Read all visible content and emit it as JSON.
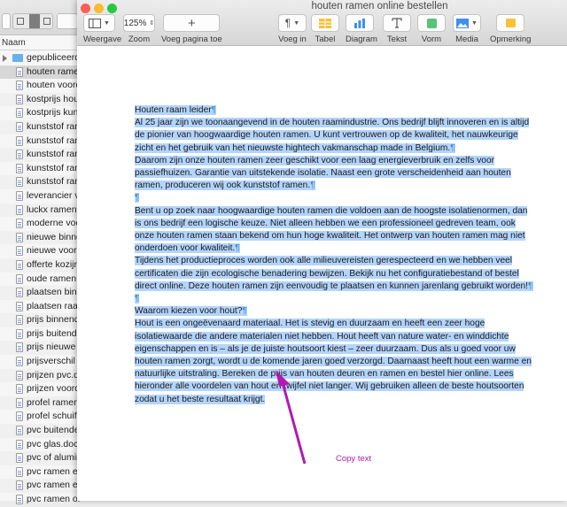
{
  "finder": {
    "column_header": "Naam",
    "rows": [
      {
        "label": "gepubliceerd",
        "kind": "folder"
      },
      {
        "label": "houten ramen",
        "kind": "file",
        "selected": true
      },
      {
        "label": "houten voord",
        "kind": "file"
      },
      {
        "label": "kostprijs hou",
        "kind": "file"
      },
      {
        "label": "kostprijs kuns",
        "kind": "file"
      },
      {
        "label": "kunststof ram",
        "kind": "file"
      },
      {
        "label": "kunststof ram",
        "kind": "file"
      },
      {
        "label": "kunststof ram",
        "kind": "file"
      },
      {
        "label": "kunststof ram",
        "kind": "file"
      },
      {
        "label": "kunststof ram",
        "kind": "file"
      },
      {
        "label": "leverancier v",
        "kind": "file"
      },
      {
        "label": "luckx ramen",
        "kind": "file"
      },
      {
        "label": "moderne voo",
        "kind": "file"
      },
      {
        "label": "nieuwe binne",
        "kind": "file"
      },
      {
        "label": "nieuwe voord",
        "kind": "file"
      },
      {
        "label": "offerte kozijn",
        "kind": "file"
      },
      {
        "label": "oude ramen v",
        "kind": "file"
      },
      {
        "label": "plaatsen binn",
        "kind": "file"
      },
      {
        "label": "plaatsen raam",
        "kind": "file"
      },
      {
        "label": "prijs binnend",
        "kind": "file"
      },
      {
        "label": "prijs buitend",
        "kind": "file"
      },
      {
        "label": "prijs nieuwe r",
        "kind": "file"
      },
      {
        "label": "prijsverschil",
        "kind": "file"
      },
      {
        "label": "prijzen pvc.d",
        "kind": "file"
      },
      {
        "label": "prijzen voord",
        "kind": "file"
      },
      {
        "label": "profel ramen",
        "kind": "file"
      },
      {
        "label": "profel schuif",
        "kind": "file"
      },
      {
        "label": "pvc buitende",
        "kind": "file"
      },
      {
        "label": "pvc glas.docx",
        "kind": "file"
      },
      {
        "label": "pvc of alumin",
        "kind": "file"
      },
      {
        "label": "pvc ramen en",
        "kind": "file"
      },
      {
        "label": "pvc ramen en",
        "kind": "file"
      },
      {
        "label": "pvc ramen or",
        "kind": "file"
      }
    ]
  },
  "window": {
    "title": "houten ramen online bestellen"
  },
  "toolbar": {
    "weergave": "Weergave",
    "zoom_label": "Zoom",
    "zoom_value": "125%",
    "add_page": "Voeg pagina toe",
    "insert": "Voeg in",
    "table": "Tabel",
    "chart": "Diagram",
    "text": "Tekst",
    "shape": "Vorm",
    "media": "Media",
    "comment": "Opmerking"
  },
  "document": {
    "paragraphs": [
      "Houten raam leider",
      "Al 25 jaar zijn we toonaangevend in de houten raamindustrie. Ons bedrijf blijft innoveren en is altijd de pionier van hoogwaardige houten ramen. U kunt vertrouwen op de kwaliteit, het nauwkeurige zicht en het gebruik van het nieuwste hightech vakmanschap made in Belgium.",
      "Daarom zijn onze houten ramen zeer geschikt voor een laag energieverbruik en zelfs voor passiefhuizen. Garantie van uitstekende isolatie. Naast een grote verscheidenheid aan houten ramen, produceren wij ook kunststof ramen.",
      "",
      "Bent u op zoek naar hoogwaardige houten ramen die voldoen aan de hoogste isolatienormen, dan is ons bedrijf een logische keuze. Niet alleen hebben we een professioneel gedreven team, ook onze houten ramen staan bekend om hun hoge kwaliteit. Het ontwerp van houten ramen mag niet onderdoen voor kwaliteit.",
      "Tijdens het productieproces worden ook alle milieuvereisten gerespecteerd en we hebben veel certificaten die zijn ecologische benadering bewijzen. Bekijk nu het configuratiebestand of bestel direct online. Deze houten ramen zijn eenvoudig te plaatsen en kunnen jarenlang gebruikt worden!",
      "",
      "Waarom kiezen voor hout?",
      "Hout is een ongeëvenaard materiaal. Het is stevig en duurzaam en heeft een zeer hoge isolatiewaarde die andere materialen niet hebben. Hout heeft van nature water- en winddichte eigenschappen en is – als je de juiste houtsoort kiest – zeer duurzaam. Dus als u goed voor uw houten ramen zorgt, wordt u de komende jaren goed verzorgd. Daarnaast heeft hout een warme en natuurlijke uitstraling. Bereken de prijs van houten deuren en ramen en bestel hier online. Lees hieronder alle voordelen van hout en twijfel niet langer. Wij gebruiken alleen de beste houtsoorten zodat u het beste resultaat krijgt."
    ],
    "pilcrow": "¶"
  },
  "annotation": {
    "text": "Copy text",
    "color": "#b11ab1"
  },
  "colors": {
    "selection": "#b3d4fc",
    "pilcrow": "#3a8fd9"
  }
}
